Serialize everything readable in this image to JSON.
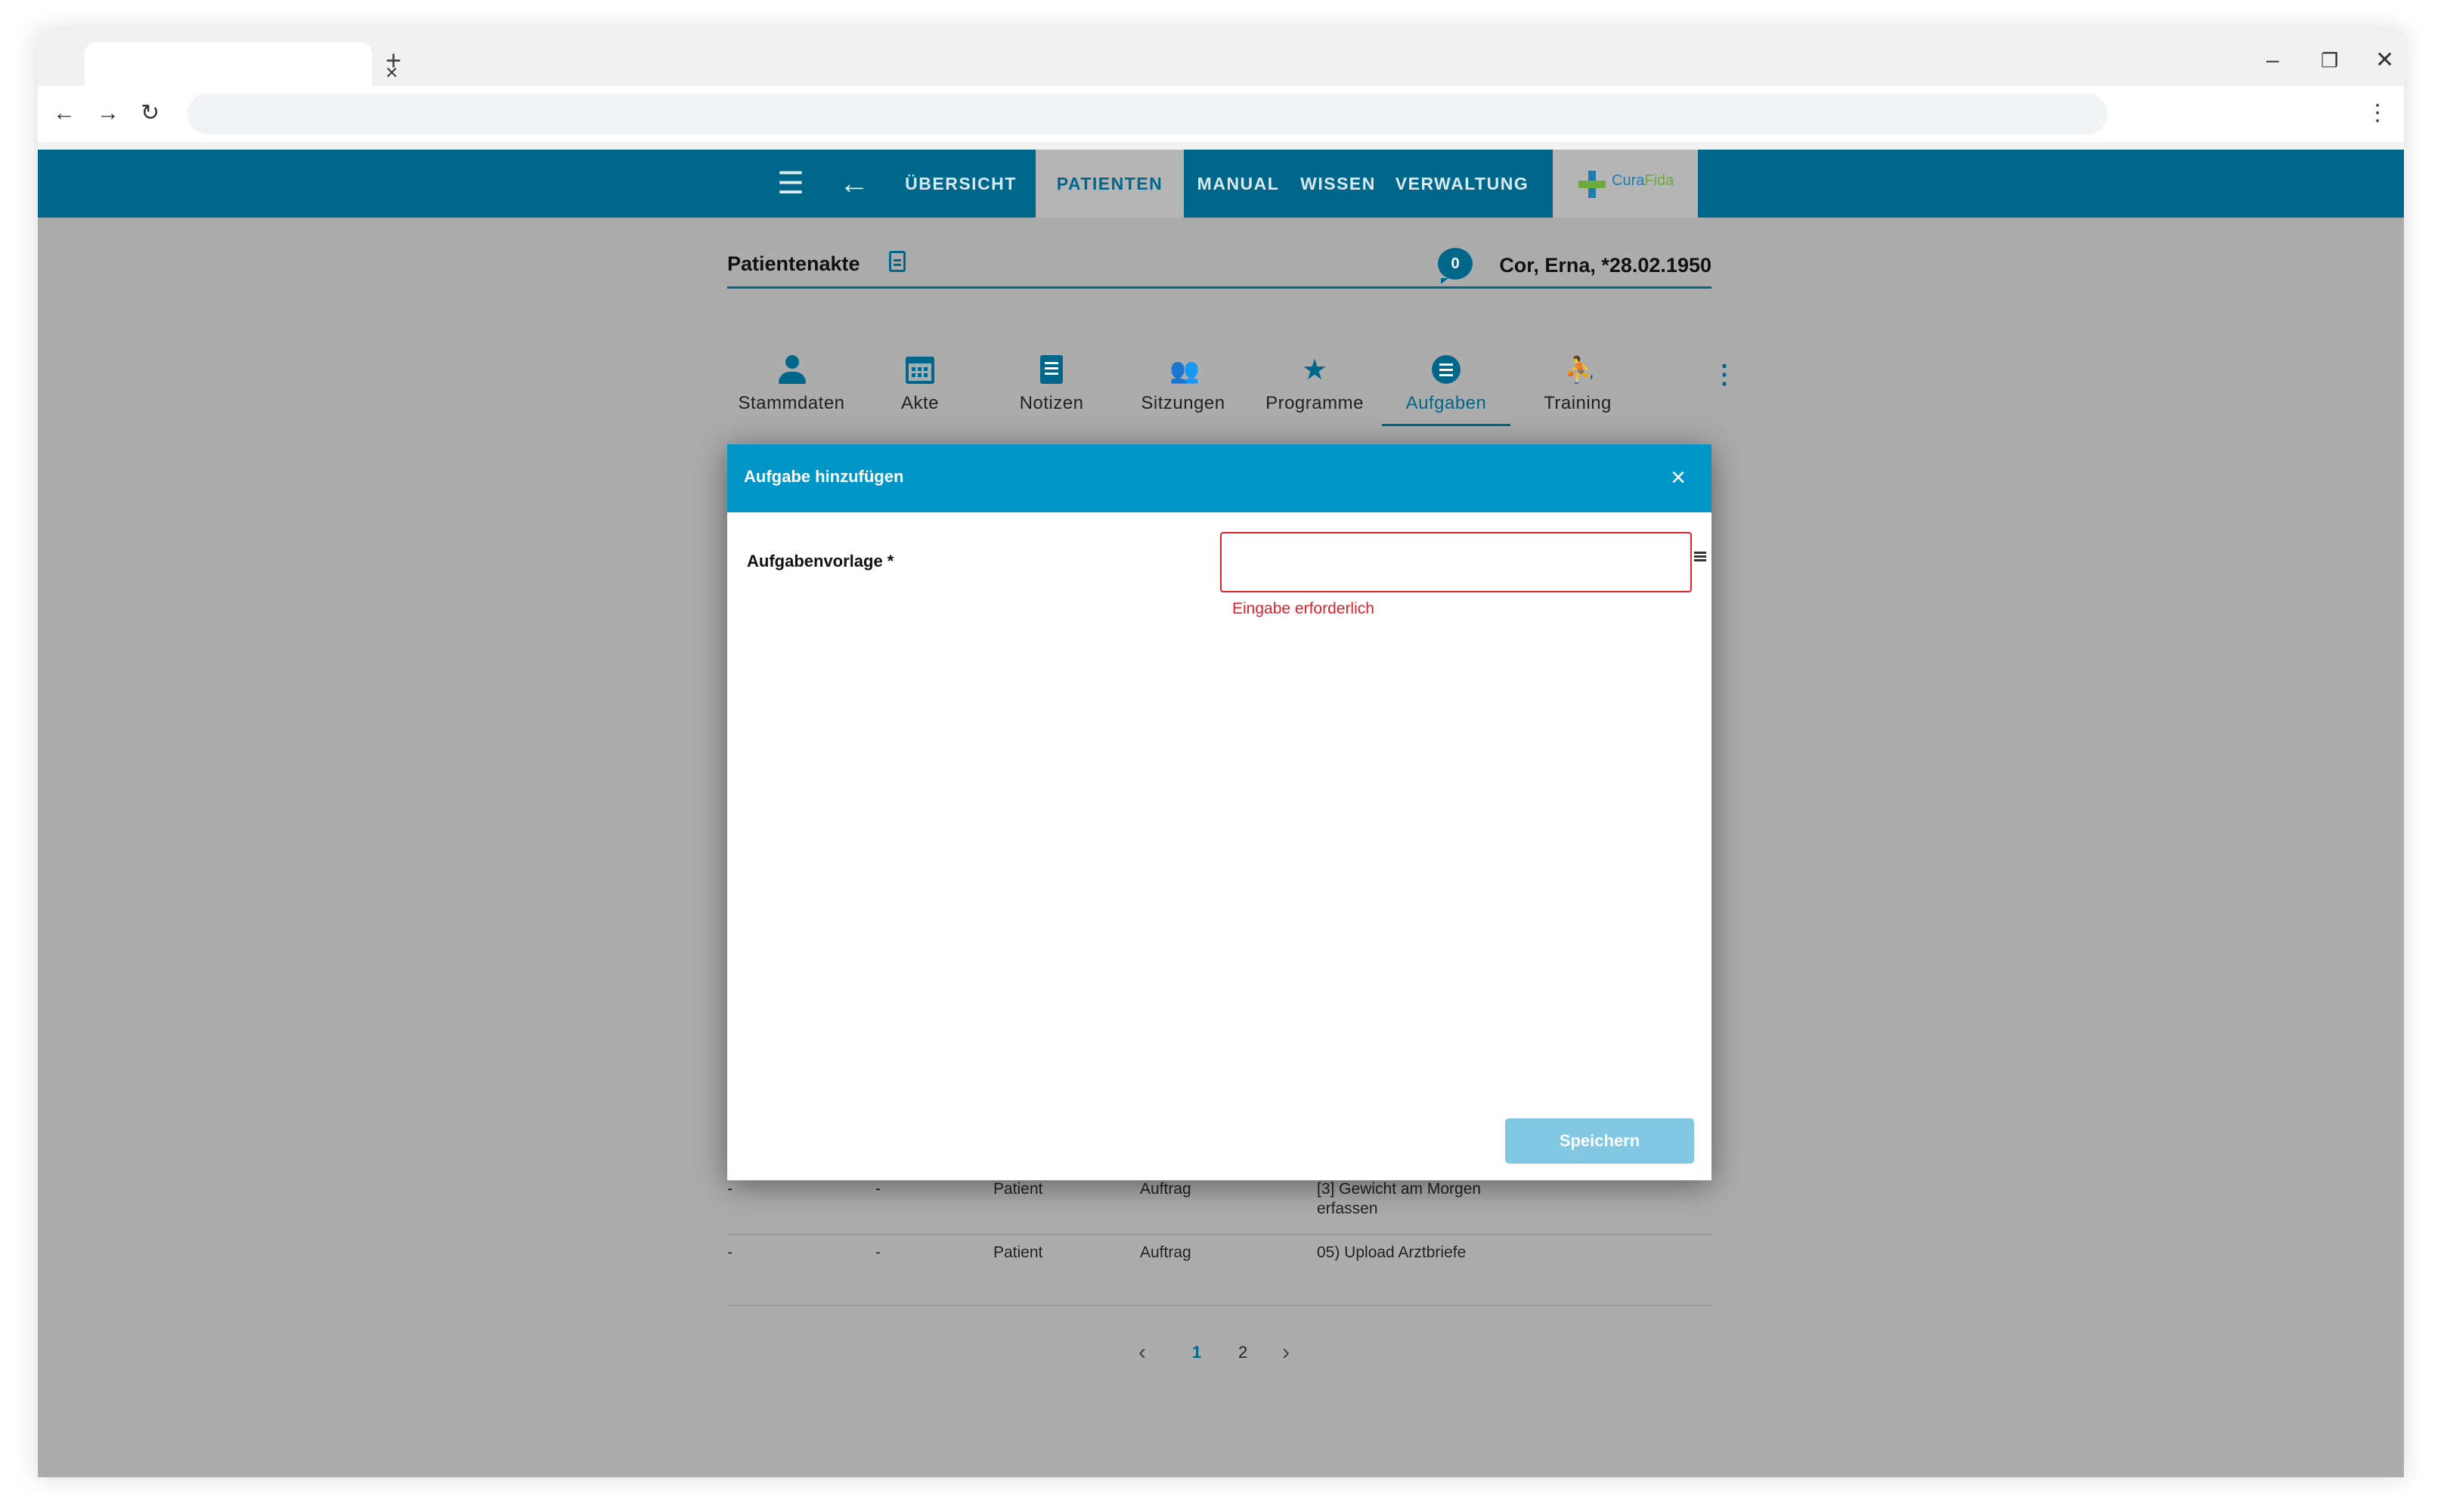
{
  "browser": {
    "tab_close": "×",
    "new_tab": "+",
    "minimize": "–",
    "restore": "❐",
    "close": "✕",
    "back": "←",
    "forward": "→",
    "reload": "↻",
    "menu": "⋮",
    "address": ""
  },
  "topnav": {
    "menu_icon": "☰",
    "back_icon": "←",
    "links": [
      "ÜBERSICHT",
      "PATIENTEN",
      "MANUAL",
      "WISSEN",
      "VERWALTUNG"
    ],
    "active": "PATIENTEN",
    "logo_cura": "Cura",
    "logo_fida": "Fida"
  },
  "page": {
    "title": "Patientenakte",
    "chat_count": "0",
    "patient": "Cor, Erna, *28.02.1950"
  },
  "subtabs": [
    {
      "label": "Stammdaten",
      "icon": "person-icon"
    },
    {
      "label": "Akte",
      "icon": "calendar-icon"
    },
    {
      "label": "Notizen",
      "icon": "note-icon"
    },
    {
      "label": "Sitzungen",
      "icon": "group-icon"
    },
    {
      "label": "Programme",
      "icon": "star-icon"
    },
    {
      "label": "Aufgaben",
      "icon": "list-icon"
    },
    {
      "label": "Training",
      "icon": "training-icon"
    }
  ],
  "active_subtab": "Aufgaben",
  "more_icon": "⋮",
  "table": {
    "rows": [
      [
        "-",
        "-",
        "Patient",
        "Auftrag",
        "[3] Gewicht am Morgen",
        "erfassen"
      ],
      [
        "-",
        "-",
        "Patient",
        "Auftrag",
        "05) Upload Arztbriefe",
        ""
      ]
    ]
  },
  "pagination": {
    "prev": "‹",
    "pages": [
      "1",
      "2"
    ],
    "current": "1",
    "next": "›"
  },
  "modal": {
    "title": "Aufgabe hinzufügen",
    "close": "×",
    "field_label": "Aufgabenvorlage *",
    "field_value": "",
    "error": "Eingabe erforderlich",
    "save": "Speichern"
  },
  "colors": {
    "nav": "#00678b",
    "modal_header": "#0096c7",
    "error": "#e0212b",
    "save_disabled": "#82c8e3",
    "overlay": "#acacac"
  }
}
